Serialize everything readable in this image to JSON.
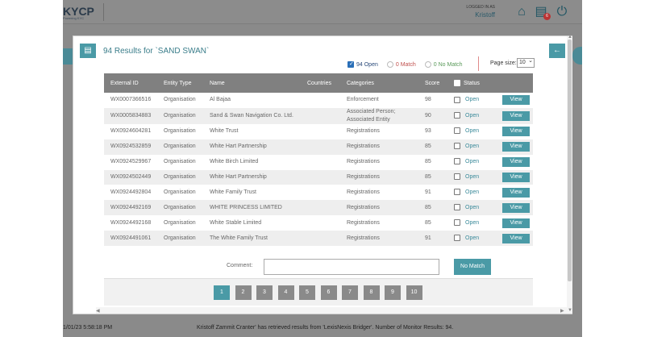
{
  "app": {
    "logo": "KYCP",
    "logo_sub": "Powering KYC",
    "logged_in_label": "LOGGED IN AS",
    "user": "Kristoff",
    "notification_count": "6",
    "status_timestamp": "1/01/23 5:58:18 PM",
    "status_message": "Kristoff Zammit Cranter' has retrieved results from 'LexisNexis Bridger'. Number of Monitor Results: 94."
  },
  "modal": {
    "title": "94 Results for `SAND SWAN`",
    "filters": {
      "open": "94 Open",
      "match": "0 Match",
      "no_match": "0 No Match"
    },
    "page_size_label": "Page size:",
    "page_size_value": "10",
    "columns": [
      "External ID",
      "Entity Type",
      "Name",
      "Countries",
      "Categories",
      "Score",
      "Status"
    ],
    "rows": [
      {
        "id": "WX0007366516",
        "type": "Organisation",
        "name": "Al Bajaa",
        "countries": "",
        "categories": "Enforcement",
        "score": "98",
        "status": "Open",
        "action": "View"
      },
      {
        "id": "WX0005834883",
        "type": "Organisation",
        "name": "Sand & Swan Navigation Co. Ltd.",
        "countries": "",
        "categories": "Associated Person; Associated Entity",
        "score": "90",
        "status": "Open",
        "action": "View"
      },
      {
        "id": "WX0924604281",
        "type": "Organisation",
        "name": "White Trust",
        "countries": "",
        "categories": "Registrations",
        "score": "93",
        "status": "Open",
        "action": "View"
      },
      {
        "id": "WX0924532859",
        "type": "Organisation",
        "name": "White Hart Partnership",
        "countries": "",
        "categories": "Registrations",
        "score": "85",
        "status": "Open",
        "action": "View"
      },
      {
        "id": "WX0924529967",
        "type": "Organisation",
        "name": "White Birch Limited",
        "countries": "",
        "categories": "Registrations",
        "score": "85",
        "status": "Open",
        "action": "View"
      },
      {
        "id": "WX0924502449",
        "type": "Organisation",
        "name": "White Hart Partnership",
        "countries": "",
        "categories": "Registrations",
        "score": "85",
        "status": "Open",
        "action": "View"
      },
      {
        "id": "WX0924492804",
        "type": "Organisation",
        "name": "White Family Trust",
        "countries": "",
        "categories": "Registrations",
        "score": "91",
        "status": "Open",
        "action": "View"
      },
      {
        "id": "WX0924492169",
        "type": "Organisation",
        "name": "WHITE PRINCESS LIMITED",
        "countries": "",
        "categories": "Registrations",
        "score": "85",
        "status": "Open",
        "action": "View"
      },
      {
        "id": "WX0924492168",
        "type": "Organisation",
        "name": "White Stable Limited",
        "countries": "",
        "categories": "Registrations",
        "score": "85",
        "status": "Open",
        "action": "View"
      },
      {
        "id": "WX0924491061",
        "type": "Organisation",
        "name": "The White Family Trust",
        "countries": "",
        "categories": "Registrations",
        "score": "91",
        "status": "Open",
        "action": "View"
      }
    ],
    "comment_label": "Comment:",
    "comment_value": "",
    "no_match_button": "No Match",
    "pages": [
      "1",
      "2",
      "3",
      "4",
      "5",
      "6",
      "7",
      "8",
      "9",
      "10"
    ],
    "active_page": "1"
  },
  "colors": {
    "accent": "#4a9aa6",
    "header": "#808080",
    "title": "#3a7d8a"
  }
}
